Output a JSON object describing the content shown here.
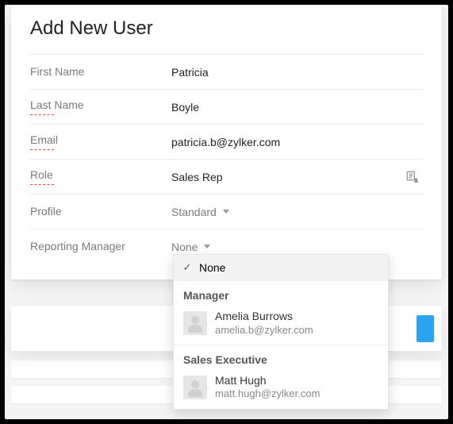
{
  "dialog": {
    "title": "Add New User"
  },
  "fields": {
    "first_name": {
      "label": "First Name",
      "value": "Patricia",
      "required": false
    },
    "last_name": {
      "label": "Last Name",
      "value": "Boyle",
      "required": true
    },
    "email": {
      "label": "Email",
      "value": "patricia.b@zylker.com",
      "required": true
    },
    "role": {
      "label": "Role",
      "value": "Sales Rep",
      "required": true
    },
    "profile": {
      "label": "Profile",
      "value": "Standard"
    },
    "manager": {
      "label": "Reporting Manager",
      "value": "None"
    }
  },
  "icons": {
    "role_picker": "role-tree-icon"
  },
  "dropdown": {
    "none_label": "None",
    "sections": [
      {
        "title": "Manager",
        "people": [
          {
            "name": "Amelia Burrows",
            "email": "amelia.b@zylker.com"
          }
        ]
      },
      {
        "title": "Sales Executive",
        "people": [
          {
            "name": "Matt Hugh",
            "email": "matt.hugh@zylker.com"
          }
        ]
      }
    ]
  }
}
